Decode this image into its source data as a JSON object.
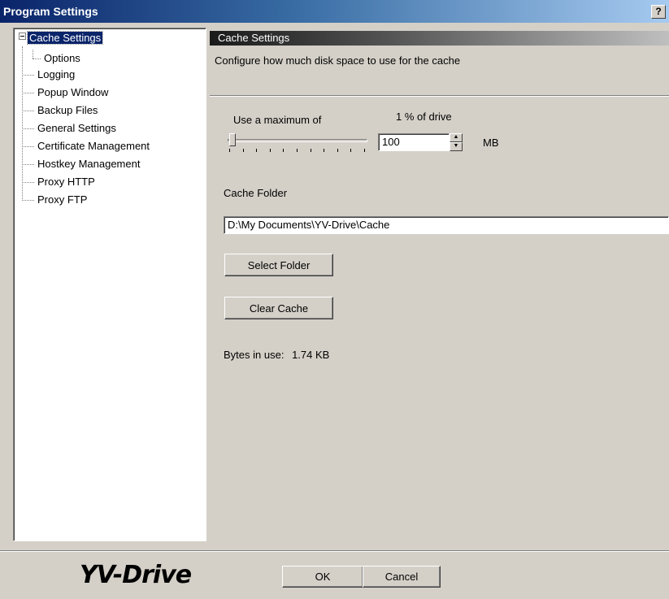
{
  "window": {
    "title": "Program Settings",
    "help_label": "?"
  },
  "tree": {
    "items": [
      {
        "label": "Cache Settings",
        "selected": true
      },
      {
        "label": "Options"
      },
      {
        "label": "Logging"
      },
      {
        "label": "Popup Window"
      },
      {
        "label": "Backup Files"
      },
      {
        "label": "General Settings"
      },
      {
        "label": "Certificate Management"
      },
      {
        "label": "Hostkey Management"
      },
      {
        "label": "Proxy HTTP"
      },
      {
        "label": "Proxy FTP"
      }
    ]
  },
  "panel": {
    "header": "Cache Settings",
    "description": "Configure how much disk space to use for the cache",
    "max_label": "Use a maximum of",
    "percent_label": "1 % of drive",
    "slider_percent": 1,
    "mb_value": "100",
    "mb_unit": "MB",
    "folder_label": "Cache Folder",
    "folder_path": "D:\\My Documents\\YV-Drive\\Cache",
    "select_folder_label": "Select Folder",
    "clear_cache_label": "Clear Cache",
    "bytes_label": "Bytes in use:",
    "bytes_value": "1.74 KB"
  },
  "footer": {
    "logo_text": "YV-Drive",
    "ok_label": "OK",
    "cancel_label": "Cancel"
  }
}
